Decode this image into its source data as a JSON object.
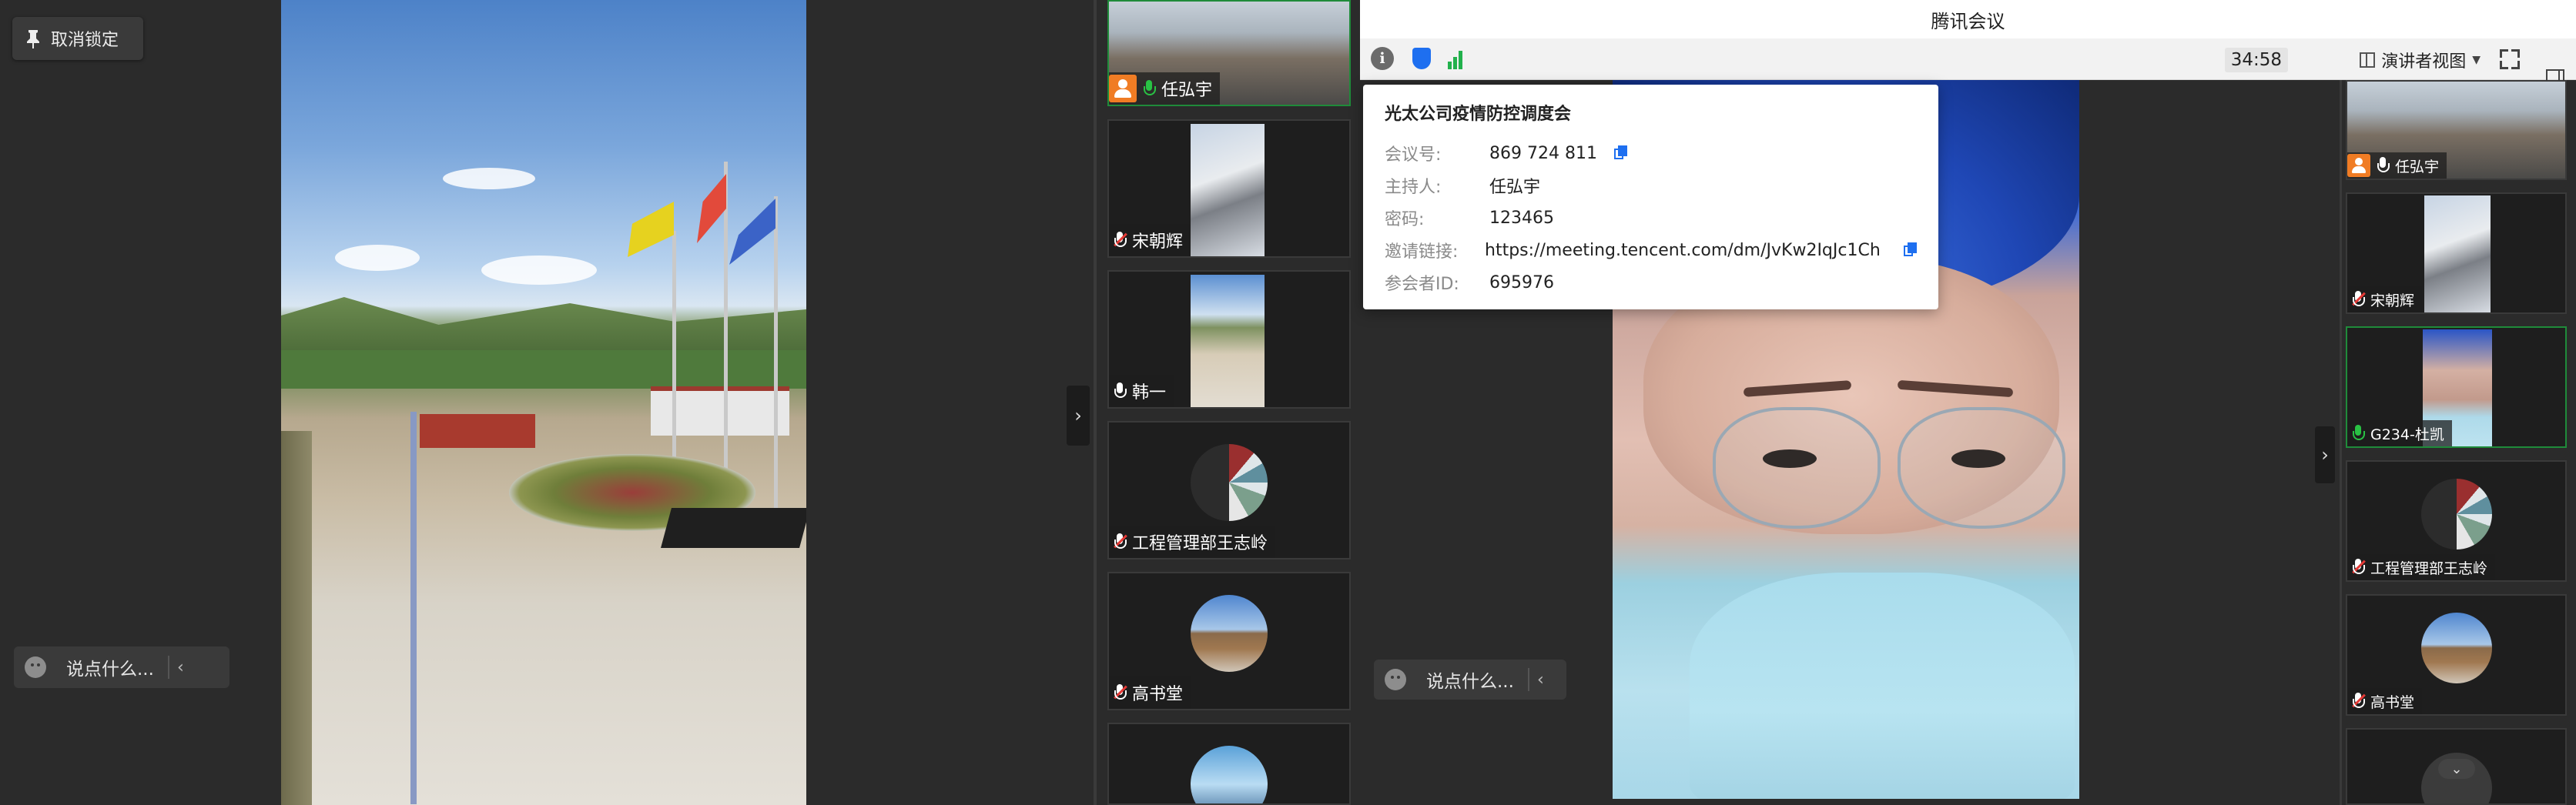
{
  "left_window": {
    "unlock_label": "取消锁定",
    "chat_placeholder": "说点什么...",
    "participants": [
      {
        "name": "任弘宇",
        "mic": "on",
        "host": true,
        "active": true
      },
      {
        "name": "宋朝辉",
        "mic": "off",
        "host": false,
        "active": false
      },
      {
        "name": "韩一",
        "mic": "muted",
        "host": false,
        "active": false
      },
      {
        "name": "工程管理部王志岭",
        "mic": "off",
        "host": false,
        "active": false
      },
      {
        "name": "高书堂",
        "mic": "off",
        "host": false,
        "active": false
      }
    ]
  },
  "right_window": {
    "app_title": "腾讯会议",
    "timer": "34:58",
    "view_mode": "演讲者视图",
    "chat_placeholder": "说点什么...",
    "meeting_info": {
      "title": "光太公司疫情防控调度会",
      "rows": [
        {
          "key": "会议号:",
          "value": "869 724 811",
          "copy": true
        },
        {
          "key": "主持人:",
          "value": "任弘宇",
          "copy": false
        },
        {
          "key": "密码:",
          "value": "123465",
          "copy": false
        },
        {
          "key": "邀请链接:",
          "value": "https://meeting.tencent.com/dm/JvKw2IqJc1Ch",
          "copy": true
        },
        {
          "key": "参会者ID:",
          "value": "695976",
          "copy": false
        }
      ]
    },
    "participants": [
      {
        "name": "任弘宇",
        "mic": "muted",
        "host": true
      },
      {
        "name": "宋朝辉",
        "mic": "off",
        "host": false
      },
      {
        "name": "G234-杜凯",
        "mic": "on",
        "host": false,
        "active": true
      },
      {
        "name": "工程管理部王志岭",
        "mic": "off",
        "host": false
      },
      {
        "name": "高书堂",
        "mic": "off",
        "host": false
      }
    ]
  },
  "colors": {
    "active_border": "#1f8b3a",
    "mic_on": "#29c244",
    "mic_off_slash": "#e53935",
    "host_badge": "#f07c24",
    "accent_blue": "#1e6ff0"
  }
}
